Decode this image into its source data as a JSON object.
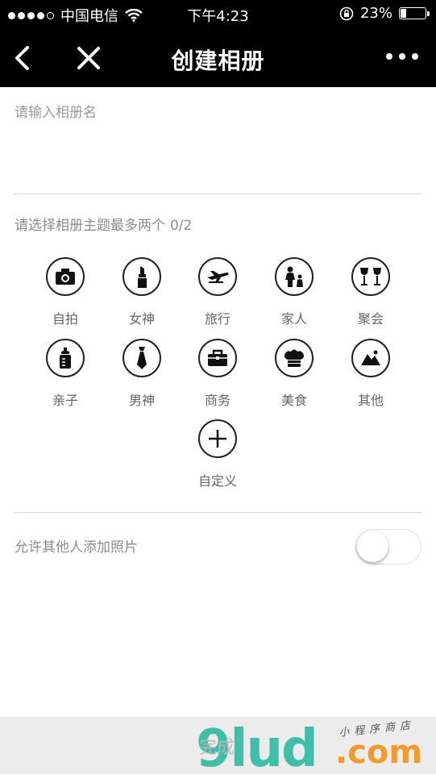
{
  "status_bar": {
    "carrier": "中国电信",
    "time": "下午4:23",
    "battery_percent": "23%",
    "battery_level": 0.23
  },
  "nav": {
    "title": "创建相册"
  },
  "album_name": {
    "placeholder": "请输入相册名",
    "value": ""
  },
  "theme_section": {
    "prompt": "请选择相册主题最多两个",
    "count": "0/2"
  },
  "themes": [
    {
      "label": "自拍",
      "icon": "camera-icon"
    },
    {
      "label": "女神",
      "icon": "lipstick-icon"
    },
    {
      "label": "旅行",
      "icon": "airplane-icon"
    },
    {
      "label": "家人",
      "icon": "family-icon"
    },
    {
      "label": "聚会",
      "icon": "wine-glasses-icon"
    },
    {
      "label": "亲子",
      "icon": "baby-bottle-icon"
    },
    {
      "label": "男神",
      "icon": "tie-icon"
    },
    {
      "label": "商务",
      "icon": "briefcase-icon"
    },
    {
      "label": "美食",
      "icon": "chef-hat-icon"
    },
    {
      "label": "其他",
      "icon": "mountain-icon"
    },
    {
      "label": "自定义",
      "icon": "plus-icon"
    }
  ],
  "allow_others": {
    "label": "允许其他人添加照片",
    "enabled": false
  },
  "footer": {
    "done_label": "完成",
    "watermark_main": "9lud",
    "watermark_domain": ".com",
    "watermark_tagline": "小程序商店"
  }
}
